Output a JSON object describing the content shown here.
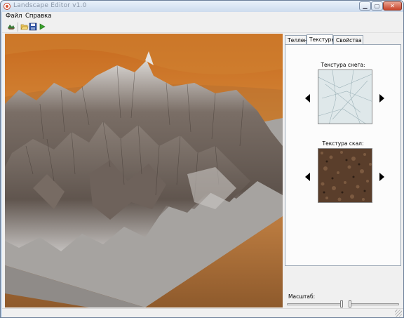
{
  "window": {
    "title": "Landscape Editor v1.0"
  },
  "menu": {
    "items": [
      "Файл",
      "Справка"
    ]
  },
  "tabs": [
    "Теллен",
    "Текстуры",
    "Свойства"
  ],
  "active_tab": 1,
  "texture_panel": {
    "top_texture_label": "Текстура снега:",
    "bottom_texture_label": "Текстура скал:"
  },
  "scale": {
    "label": "Масштаб:",
    "slider1_value": 1.0,
    "slider2_value": 0.0
  },
  "colors": {
    "accent_close": "#c8442a",
    "sky": "#c77a2c",
    "terrain": "#6b5f57",
    "ground": "#a7a4a1"
  },
  "icons": [
    "map-icon",
    "open-folder-icon",
    "save-icon",
    "run-icon"
  ]
}
